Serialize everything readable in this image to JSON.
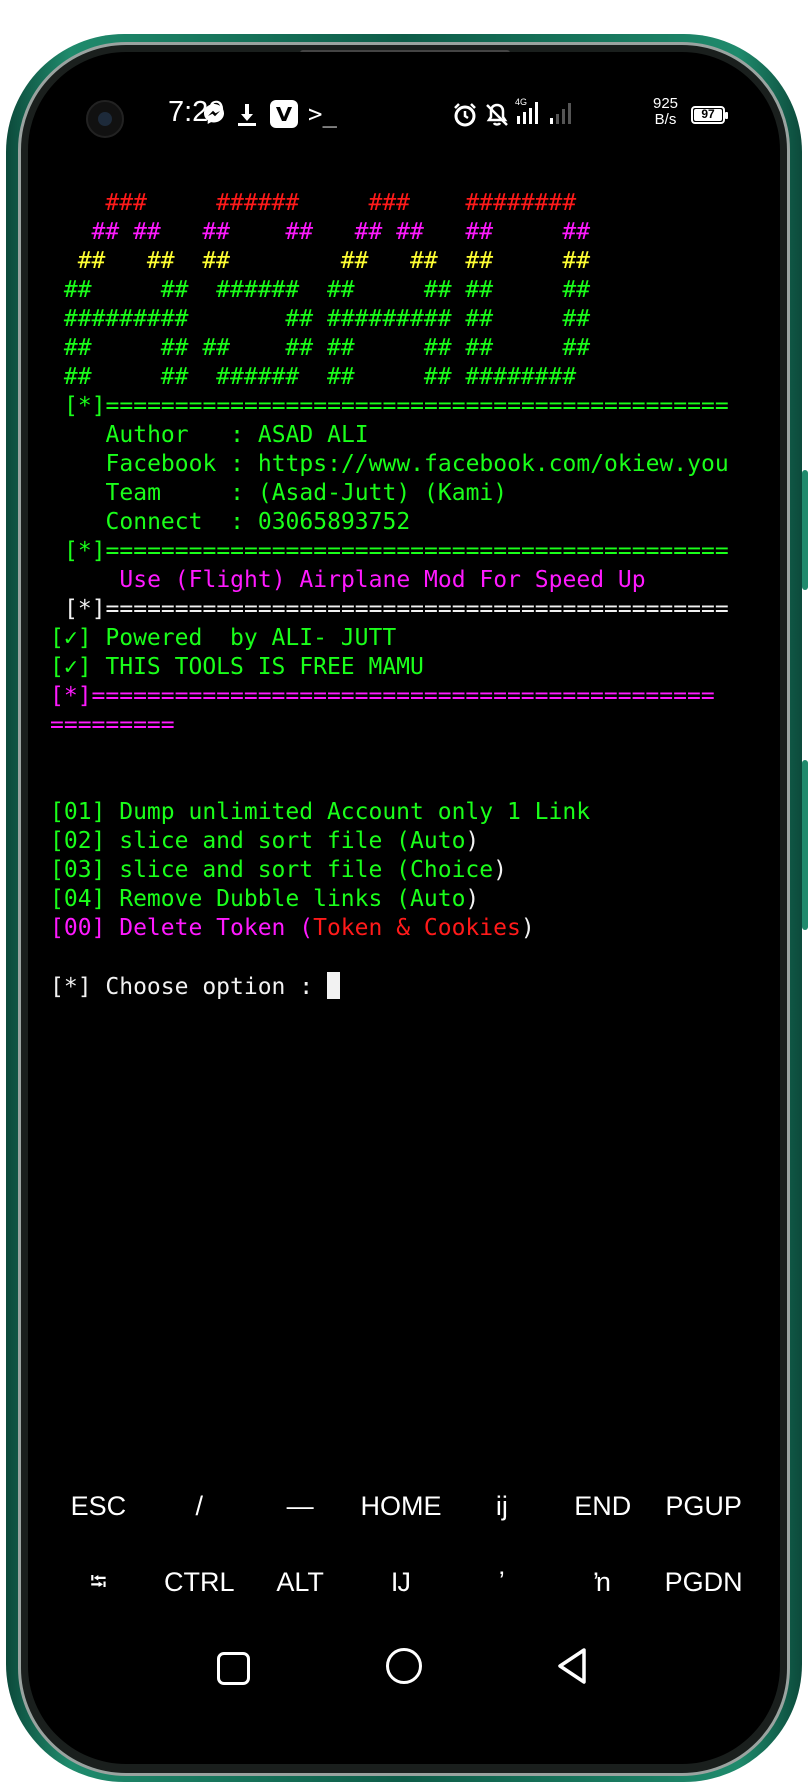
{
  "status_bar": {
    "time": "7:29",
    "net_speed_value": "925",
    "net_speed_unit": "B/s",
    "battery": "97",
    "network": "4G",
    "icons": [
      "messenger-icon",
      "download-icon",
      "v-app-icon",
      "terminal-icon",
      "alarm-icon",
      "mute-bell-icon",
      "signal-icon",
      "signal-weak-icon"
    ]
  },
  "terminal": {
    "banner_lines": [
      "    ###     ######     ###    ########",
      "   ## ##   ##    ##   ## ##   ##     ##",
      "  ##   ##  ##        ##   ##  ##     ##",
      " ##     ##  ######  ##     ## ##     ##",
      " #########       ## ######### ##     ##",
      " ##     ## ##    ## ##     ## ##     ##",
      " ##     ##  ######  ##     ## ########"
    ],
    "banner_colors": [
      "red",
      "mag",
      "yel",
      "grn",
      "grn",
      "grn",
      "grn"
    ],
    "separator": "[*]=============================================",
    "info": {
      "author": "   Author   : ASAD ALI",
      "facebook": "   Facebook : https://www.facebook.com/okiew.you",
      "team": "   Team     : (Asad-Jutt) (Kami)",
      "connect": "   Connect  : 03065893752"
    },
    "tip": "    Use (Flight) Airplane Mod For Speed Up",
    "powered": "[✓] Powered  by ALI- JUTT",
    "free": "[✓] THIS TOOLS IS FREE MAMU",
    "magenta_separator": "[*]=============================================",
    "magenta_wrap": "=========",
    "menu": {
      "opt1": {
        "prefix": "[01] Dump unlimited Account only 1 Link",
        "suffix": ""
      },
      "opt2": {
        "prefix": "[02] slice and sort file (Auto",
        "suffix": ")"
      },
      "opt3": {
        "prefix": "[03] slice and sort file (Choice",
        "suffix": ")"
      },
      "opt4": {
        "prefix": "[04] Remove Dubble links (Auto",
        "suffix": ")"
      },
      "opt0": {
        "prefix": "[00] Delete Token (",
        "red": "Token & Cookies",
        "suffix": ")"
      }
    },
    "prompt": "[*] Choose option : "
  },
  "extra_keys": {
    "row1": [
      "ESC",
      "/",
      "—",
      "HOME",
      "ij",
      "END",
      "PGUP"
    ],
    "row2": [
      "⭾",
      "CTRL",
      "ALT",
      "Ĳ",
      "ʼ",
      "ŉ",
      "PGDN"
    ]
  },
  "navigation": {
    "icons": [
      "recent-apps-icon",
      "home-icon",
      "back-icon"
    ]
  }
}
